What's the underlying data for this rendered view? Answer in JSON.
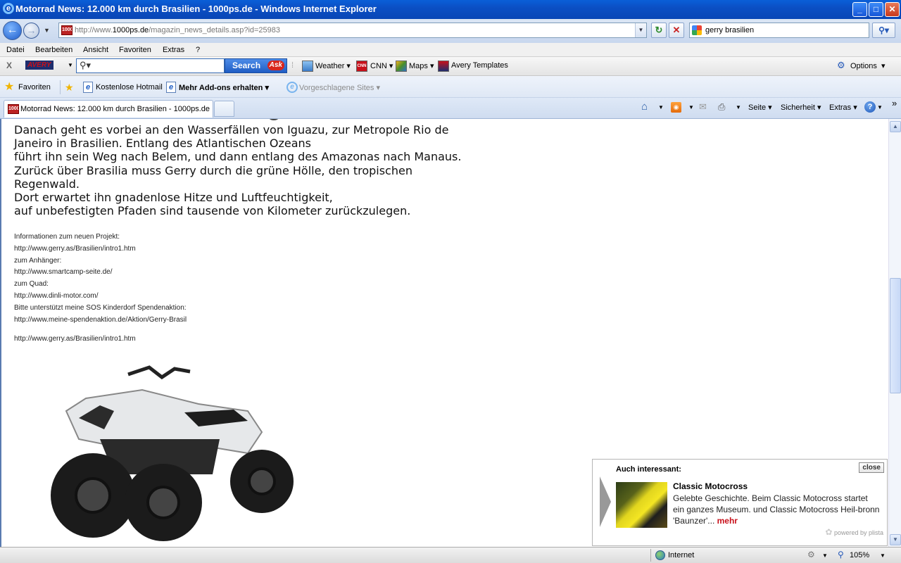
{
  "window": {
    "title": "Motorrad News: 12.000 km durch Brasilien  - 1000ps.de - Windows Internet Explorer",
    "minimize": "_",
    "maximize": "□",
    "close": "✕"
  },
  "address": {
    "url_prefix": "http://www.",
    "url_domain": "1000ps.de",
    "url_path": "/magazin_news_details.asp?id=25983",
    "favicon_text": "1000"
  },
  "search": {
    "value": "gerry brasilien"
  },
  "menu": [
    "Datei",
    "Bearbeiten",
    "Ansicht",
    "Favoriten",
    "Extras",
    "?"
  ],
  "ask_toolbar": {
    "close": "X",
    "avery": "AVERY",
    "search_label": "Search",
    "ask_logo": "Ask",
    "weather": "Weather",
    "cnn": "CNN",
    "maps": "Maps",
    "avery_templates": "Avery Templates",
    "options": "Options"
  },
  "favorites_bar": {
    "favorites": "Favoriten",
    "hotmail": "Kostenlose Hotmail",
    "addons": "Mehr Add-ons erhalten",
    "suggested": "Vorgeschlagene Sites"
  },
  "tab": {
    "title": "Motorrad News: 12.000 km durch Brasilien  - 1000ps.de"
  },
  "command_bar": {
    "page": "Seite",
    "security": "Sicherheit",
    "tools": "Extras",
    "more": "»"
  },
  "article": {
    "lines": [
      "Danach geht es vorbei an den Wasserfällen von Iguazu, zur Metropole Rio de",
      "Janeiro in Brasilien. Entlang des Atlantischen Ozeans",
      "führt ihn sein Weg nach Belem, und dann entlang des Amazonas nach Manaus.",
      "Zurück über Brasilia muss Gerry durch die grüne Hölle, den tropischen",
      "Regenwald.",
      "Dort erwartet ihn gnadenlose Hitze und Luftfeuchtigkeit,",
      "auf unbefestigten Pfaden sind tausende von Kilometer zurückzulegen."
    ],
    "info": [
      "Informationen zum neuen Projekt:",
      "http://www.gerry.as/Brasilien/intro1.htm",
      "zum Anhänger:",
      "http://www.smartcamp-seite.de/",
      "zum Quad:",
      "http://www.dinli-motor.com/",
      "Bitte unterstützt meine SOS Kinderdorf Spendenaktion:",
      "http://www.meine-spendenaktion.de/Aktion/Gerry-Brasil",
      "",
      "http://www.gerry.as/Brasilien/intro1.htm"
    ]
  },
  "popup": {
    "heading": "Auch interessant:",
    "close": "close",
    "title": "Classic Motocross",
    "description": "Gelebte Geschichte. Beim Classic Motocross startet ein ganzes Museum. und Classic Motocross Heil-bronn 'Baunzer'...",
    "more": "mehr",
    "powered": "powered by plista"
  },
  "statusbar": {
    "zone": "Internet",
    "zoom": "105%"
  }
}
